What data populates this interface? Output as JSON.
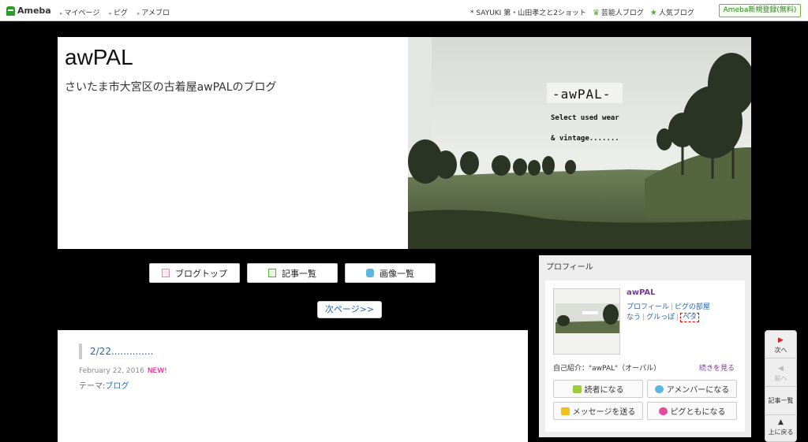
{
  "topbar": {
    "logo": "Ameba",
    "nav": [
      "マイページ",
      "ピグ",
      "アメブロ"
    ],
    "news": "* SAYUKI 第・山田孝之と2ショット",
    "links": [
      "芸能人ブログ",
      "人気ブログ"
    ],
    "signup": "Ameba新規登録(無料)"
  },
  "header": {
    "title": "awPAL",
    "description": "さいたま市大宮区の古着屋awPALのブログ",
    "image_text": [
      "-awPAL-",
      "Select used wear",
      "& vintage......."
    ]
  },
  "nav_buttons": [
    "ブログトップ",
    "記事一覧",
    "画像一覧"
  ],
  "next_page": "次ページ>>",
  "article": {
    "title": "2/22..............",
    "date": "February 22, 2016",
    "new_badge": "NEW!",
    "theme_label": "テーマ:",
    "theme": "ブログ"
  },
  "profile": {
    "heading": "プロフィール",
    "name": "awPAL",
    "links": [
      "プロフィール",
      "ピグの部屋",
      "なう",
      "グルっぽ",
      "ペタ"
    ],
    "intro": "自己紹介：\"awPAL\"（オーパル）",
    "more": "続きを見る",
    "buttons": [
      "読者になる",
      "アメンバーになる",
      "メッセージを送る",
      "ピグともになる"
    ]
  },
  "float_panel": [
    "次へ",
    "前へ",
    "記事一覧",
    "上に戻る"
  ],
  "colors": {
    "accent_green": "#2d9a2d",
    "link_blue": "#2266bb",
    "purple": "#7a3a9a",
    "new_pink": "#e0007a"
  }
}
